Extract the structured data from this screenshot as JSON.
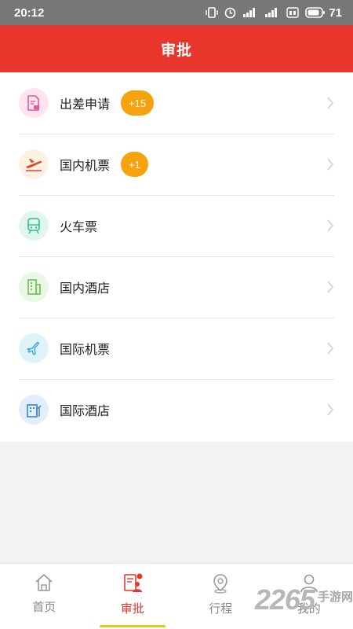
{
  "status_bar": {
    "time": "20:12",
    "battery": "71"
  },
  "header": {
    "title": "审批"
  },
  "items": [
    {
      "label": "出差申请",
      "badge": "+15",
      "icon": "document-icon",
      "icon_bg": "#fde4ef",
      "icon_color": "#e25b9a"
    },
    {
      "label": "国内机票",
      "badge": "+1",
      "icon": "plane-takeoff-icon",
      "icon_bg": "#fdf1e2",
      "icon_color": "#e2452b"
    },
    {
      "label": "火车票",
      "badge": "",
      "icon": "train-icon",
      "icon_bg": "#dff7ef",
      "icon_color": "#37b98b"
    },
    {
      "label": "国内酒店",
      "badge": "",
      "icon": "building-icon",
      "icon_bg": "#eaf7e4",
      "icon_color": "#6cbf4e"
    },
    {
      "label": "国际机票",
      "badge": "",
      "icon": "plane-icon",
      "icon_bg": "#e0f3fa",
      "icon_color": "#3fb0d6"
    },
    {
      "label": "国际酒店",
      "badge": "",
      "icon": "hotel-icon",
      "icon_bg": "#e2eefa",
      "icon_color": "#3b84c9"
    }
  ],
  "tabbar": {
    "tabs": [
      {
        "label": "首页",
        "icon": "home-icon",
        "active": false
      },
      {
        "label": "审批",
        "icon": "approval-icon",
        "active": true
      },
      {
        "label": "行程",
        "icon": "location-icon",
        "active": false
      },
      {
        "label": "我的",
        "icon": "user-icon",
        "active": false
      }
    ]
  },
  "watermark": {
    "number": "2265",
    "text": "手游网"
  },
  "colors": {
    "brand": "#e8362d",
    "badge": "#f6a20c",
    "indicator": "#f0c419"
  }
}
